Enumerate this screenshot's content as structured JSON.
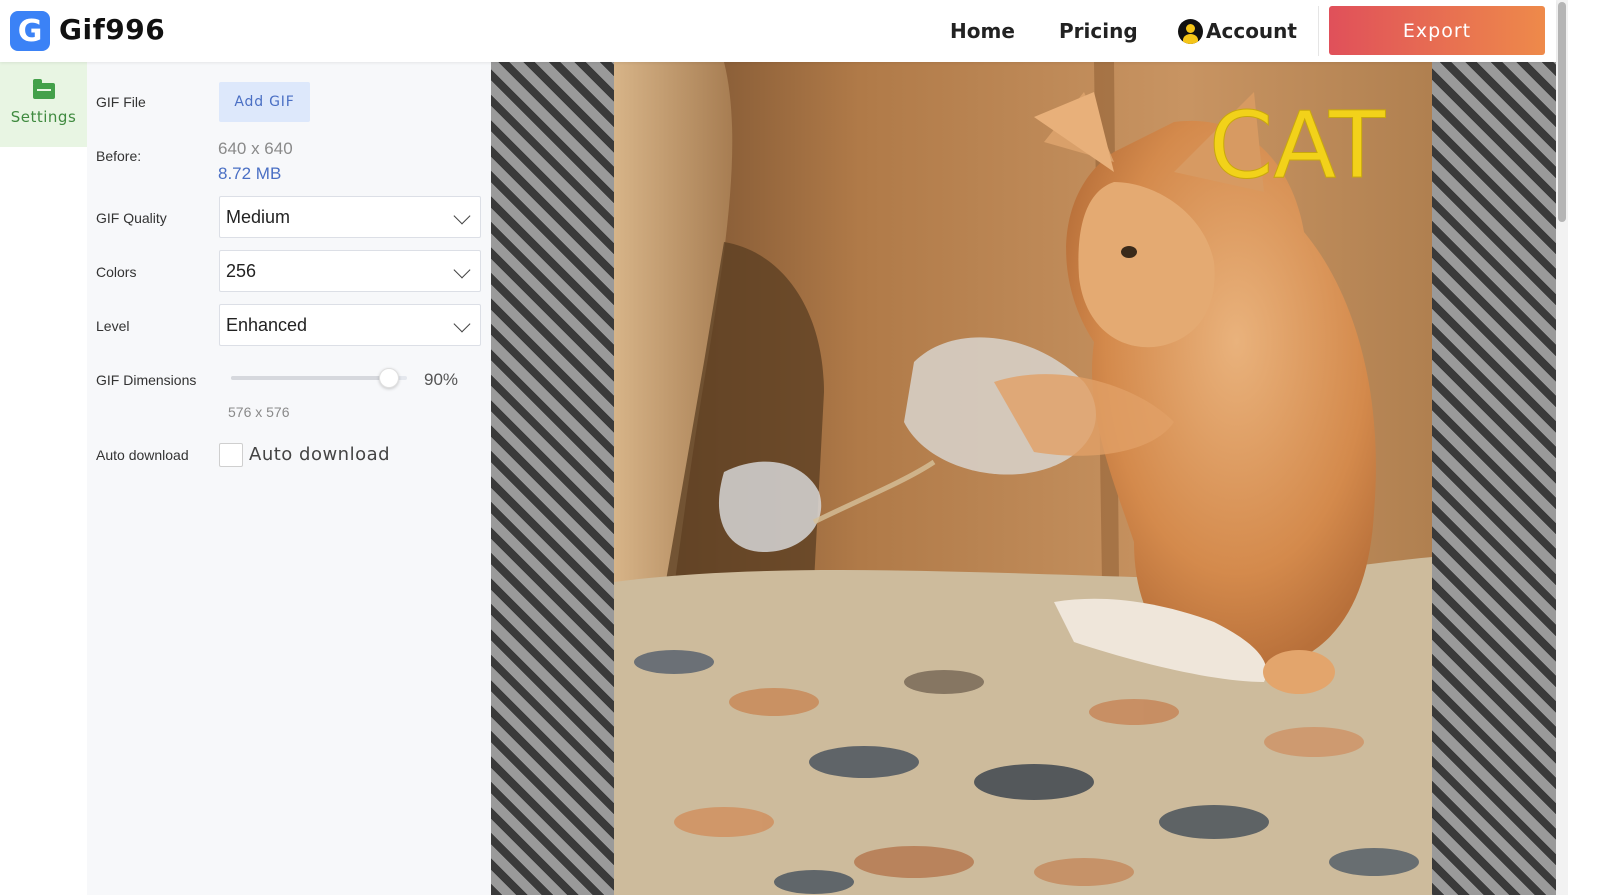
{
  "header": {
    "logo_letter": "G",
    "brand": "Gif996",
    "nav": {
      "home": "Home",
      "pricing": "Pricing",
      "account": "Account"
    },
    "export_label": "Export"
  },
  "sidebar": {
    "tabs": [
      {
        "label": "Settings",
        "icon": "folder-icon",
        "active": true
      }
    ]
  },
  "settings": {
    "gif_file_label": "GIF File",
    "add_gif_label": "Add GIF",
    "before_label": "Before:",
    "before_dims": "640 x 640",
    "before_size": "8.72 MB",
    "quality_label": "GIF Quality",
    "quality_value": "Medium",
    "colors_label": "Colors",
    "colors_value": "256",
    "level_label": "Level",
    "level_value": "Enhanced",
    "dimensions_label": "GIF Dimensions",
    "dimensions_percent": 90,
    "dimensions_percent_text": "90%",
    "output_dims": "576 x 576",
    "auto_download_label": "Auto download",
    "auto_download_checkbox_label": "Auto download",
    "auto_download_checked": false
  },
  "preview": {
    "overlay_text": "CAT",
    "overlay_color": "#f2d21a"
  },
  "colors": {
    "accent_green": "#43a04a",
    "accent_blue": "#4a6fc4",
    "export_gradient_start": "#e0505a",
    "export_gradient_end": "#ee8a4a"
  }
}
